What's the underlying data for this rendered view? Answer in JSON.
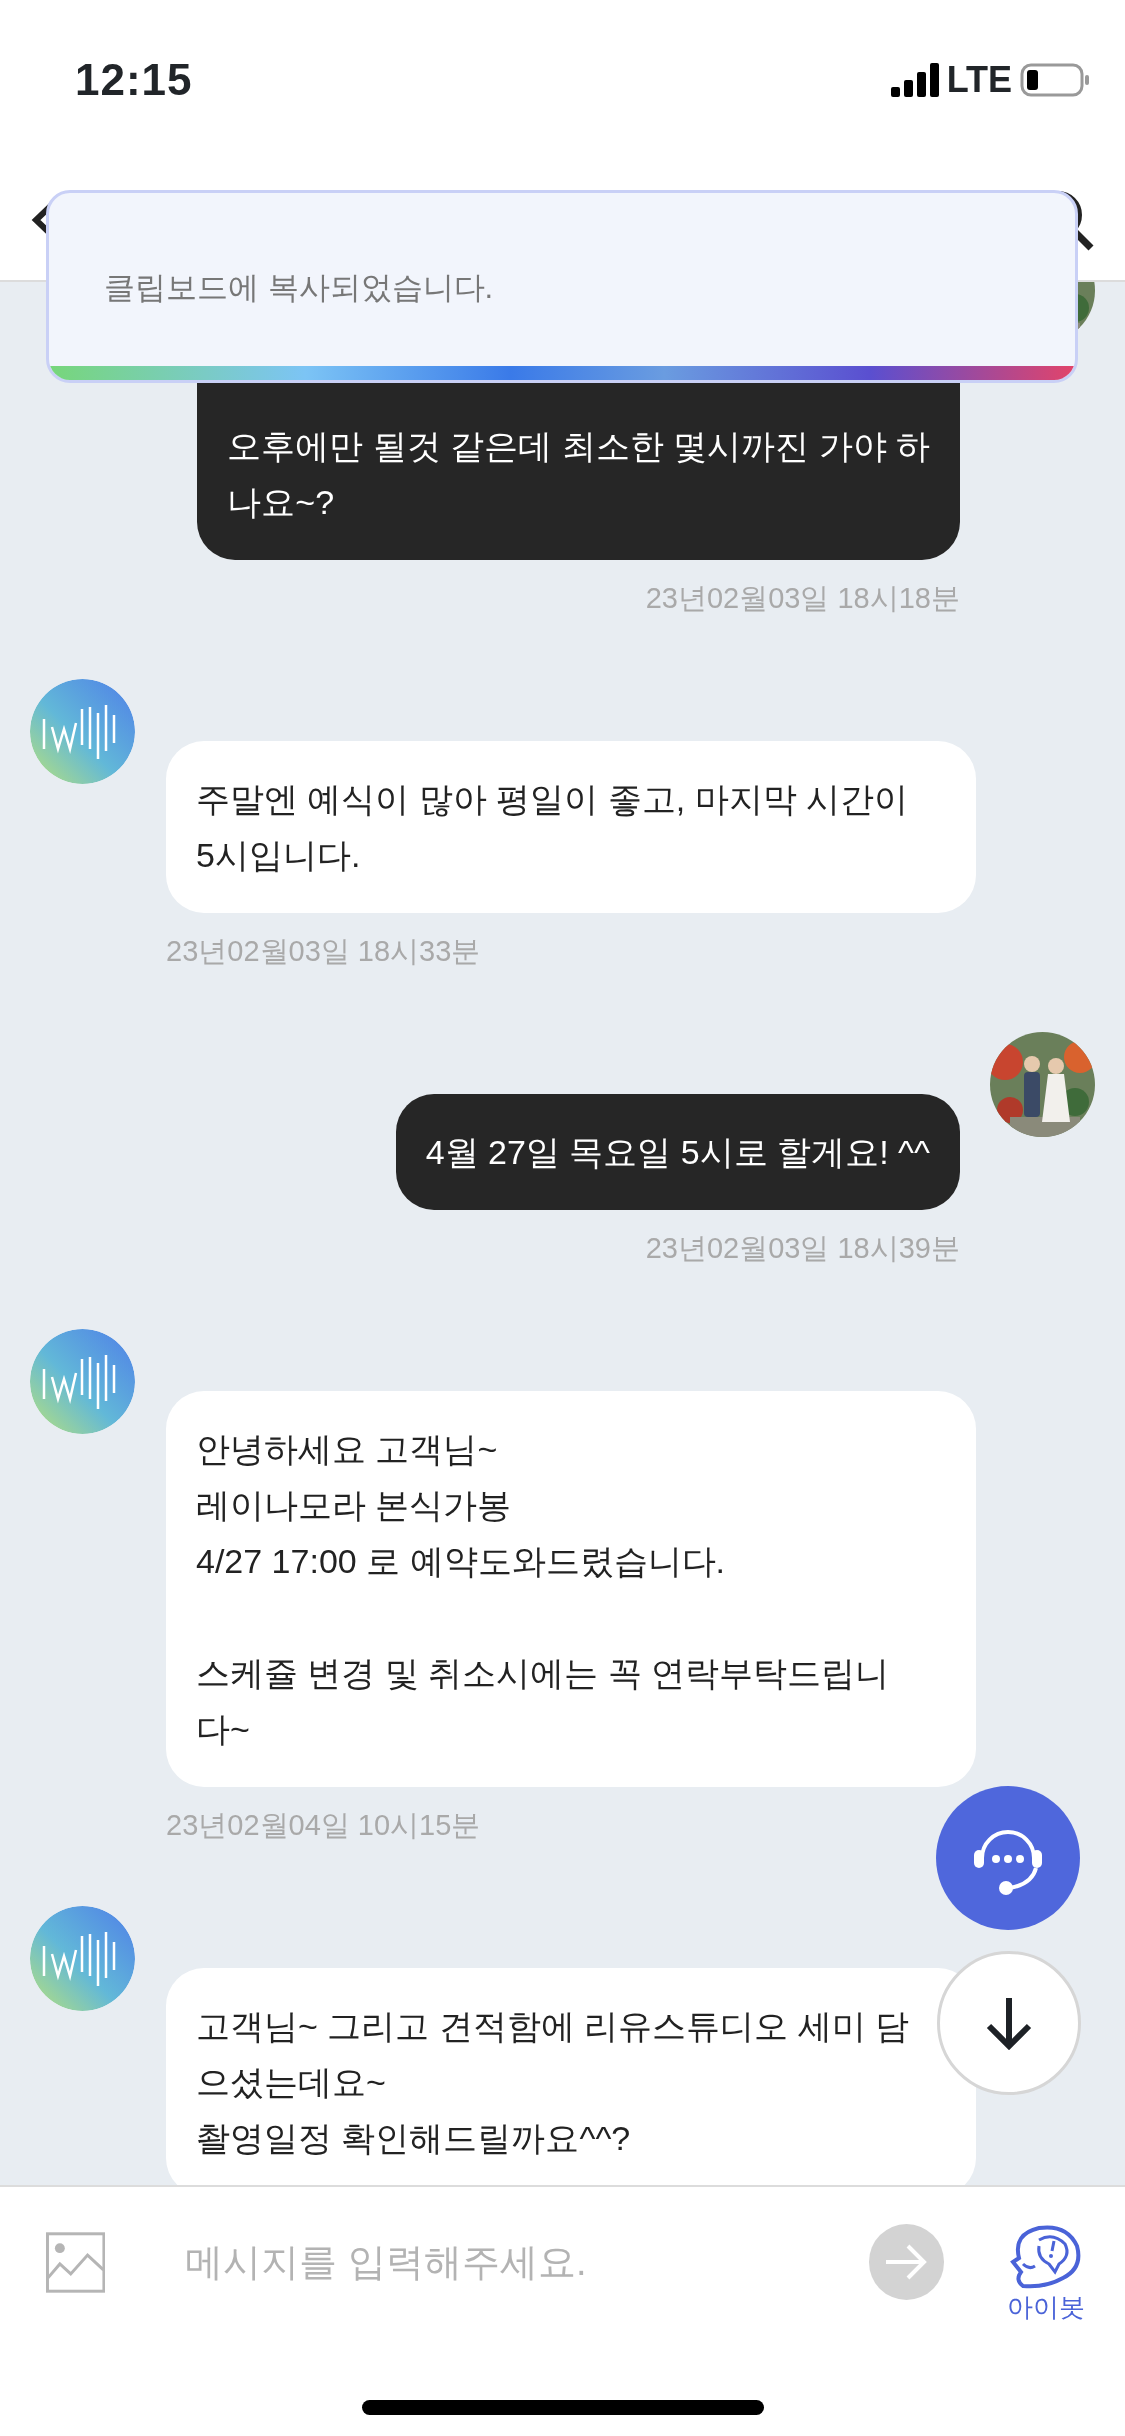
{
  "status_bar": {
    "time": "12:15",
    "network": "LTE"
  },
  "toast": {
    "text": "클립보드에 복사되었습니다."
  },
  "messages": [
    {
      "kind": "me",
      "text": "오후에만 될것 같은데 최소한 몇시까진 가야 하\n나요~?",
      "time": "23년02월03일 18시18분"
    },
    {
      "kind": "bot",
      "text": "주말엔 예식이 많아 평일이 좋고, 마지막 시간이\n5시입니다.",
      "time": "23년02월03일 18시33분"
    },
    {
      "kind": "me",
      "text": "4월 27일 목요일 5시로 할게요! ^^",
      "time": "23년02월03일 18시39분"
    },
    {
      "kind": "bot",
      "text": "안녕하세요 고객님~\n레이나모라 본식가봉\n4/27 17:00 로 예약도와드렸습니다.\n\n스케쥴 변경 및 취소시에는 꼭 연락부탁드립니\n다~",
      "time": "23년02월04일 10시15분"
    },
    {
      "kind": "bot",
      "text": "고객님~ 그리고 견적함에 리유스튜디오 세미 담\n으셨는데요~\n촬영일정 확인해드릴까요^^?"
    }
  ],
  "composer": {
    "placeholder": "메시지를 입력해주세요.",
    "bot_label": "아이봇"
  }
}
